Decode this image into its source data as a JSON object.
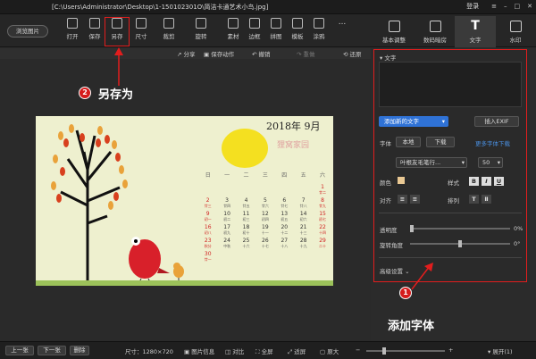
{
  "titlebar": {
    "path": "[C:\\Users\\Administrator\\Desktop\\1-150102301O\\简洁卡通艺术小鸟.jpg]",
    "login": "登录"
  },
  "toolbar": {
    "browse": "浏览图片",
    "tools": [
      "打开",
      "保存",
      "另存",
      "尺寸",
      "裁剪",
      "旋转",
      "素材",
      "边框",
      "拼图",
      "模板",
      "涂鸦",
      "..."
    ]
  },
  "sidetabs": [
    "基本调整",
    "数码暗房",
    "文字",
    "水印"
  ],
  "subbar": {
    "share": "分享",
    "save_action": "保存动作",
    "undo": "撤销",
    "redo": "重做",
    "restore": "还原"
  },
  "calendar": {
    "title": "2018年  9月",
    "stamp": "狸窝家园",
    "weekdays": [
      "日",
      "一",
      "二",
      "三",
      "四",
      "五",
      "六"
    ],
    "rows": [
      [
        {
          "d": "",
          "s": ""
        },
        {
          "d": "",
          "s": ""
        },
        {
          "d": "",
          "s": ""
        },
        {
          "d": "",
          "s": ""
        },
        {
          "d": "",
          "s": ""
        },
        {
          "d": "",
          "s": ""
        },
        {
          "d": "1",
          "s": "廿二",
          "r": true
        }
      ],
      [
        {
          "d": "2",
          "s": "廿三",
          "r": true
        },
        {
          "d": "3",
          "s": "廿四"
        },
        {
          "d": "4",
          "s": "廿五"
        },
        {
          "d": "5",
          "s": "廿六"
        },
        {
          "d": "6",
          "s": "廿七"
        },
        {
          "d": "7",
          "s": "廿八"
        },
        {
          "d": "8",
          "s": "廿九",
          "r": true
        }
      ],
      [
        {
          "d": "9",
          "s": "初一",
          "r": true
        },
        {
          "d": "10",
          "s": "初二"
        },
        {
          "d": "11",
          "s": "初三"
        },
        {
          "d": "12",
          "s": "初四"
        },
        {
          "d": "13",
          "s": "初五"
        },
        {
          "d": "14",
          "s": "初六"
        },
        {
          "d": "15",
          "s": "初七",
          "r": true
        }
      ],
      [
        {
          "d": "16",
          "s": "初八",
          "r": true
        },
        {
          "d": "17",
          "s": "初九"
        },
        {
          "d": "18",
          "s": "初十"
        },
        {
          "d": "19",
          "s": "十一"
        },
        {
          "d": "20",
          "s": "十二"
        },
        {
          "d": "21",
          "s": "十三"
        },
        {
          "d": "22",
          "s": "十四",
          "r": true
        }
      ],
      [
        {
          "d": "23",
          "s": "秋分",
          "r": true
        },
        {
          "d": "24",
          "s": "中秋"
        },
        {
          "d": "25",
          "s": "十六"
        },
        {
          "d": "26",
          "s": "十七"
        },
        {
          "d": "27",
          "s": "十八"
        },
        {
          "d": "28",
          "s": "十九"
        },
        {
          "d": "29",
          "s": "二十",
          "r": true
        }
      ],
      [
        {
          "d": "30",
          "s": "廿一",
          "r": true
        },
        {
          "d": "",
          "s": ""
        },
        {
          "d": "",
          "s": ""
        },
        {
          "d": "",
          "s": ""
        },
        {
          "d": "",
          "s": ""
        },
        {
          "d": "",
          "s": ""
        },
        {
          "d": "",
          "s": ""
        }
      ]
    ]
  },
  "panel": {
    "text_label": "文字",
    "add_text": "添加新的文字",
    "insert_exif": "插入EXIF",
    "font_label": "字体",
    "local": "本地",
    "download": "下载",
    "more_fonts": "更多字体下载",
    "font_name": "叶根友毛笔行...",
    "font_size": "50",
    "color_label": "颜色",
    "style_label": "样式",
    "align_label": "对齐",
    "arrange_label": "排列",
    "opacity_label": "透明度",
    "opacity_value": "0%",
    "rotate_label": "旋转角度",
    "rotate_value": "0°",
    "advanced": "高级设置",
    "style_b": "B",
    "style_i": "I",
    "style_u": "U",
    "text_color": "#e9c893",
    "opacity_level": 0.0,
    "rotation_level": 0.5
  },
  "annotations": {
    "n1": "1",
    "n2": "2",
    "save_as": "另存为",
    "add_font": "添加字体"
  },
  "bottombar": {
    "prev": "上一张",
    "next": "下一张",
    "delete": "删除",
    "size": "尺寸：1280×720",
    "info": "图片信息",
    "compare": "对比",
    "fullscreen": "全屏",
    "fit": "适屏",
    "original": "原大",
    "expand": "展开(1)"
  }
}
